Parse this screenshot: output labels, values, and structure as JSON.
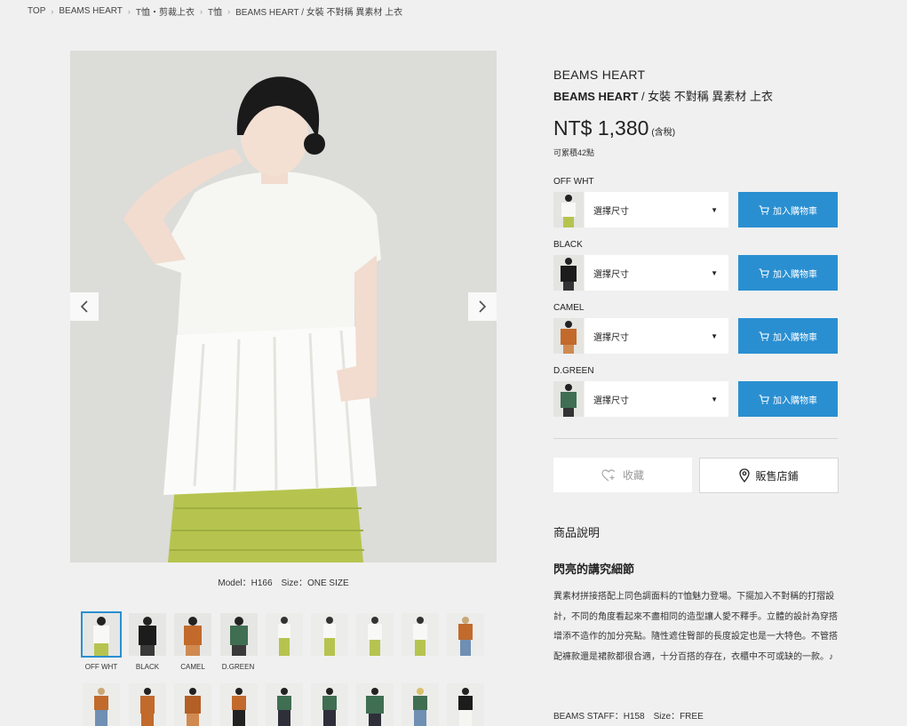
{
  "breadcrumb": [
    "TOP",
    "BEAMS HEART",
    "T恤・剪裁上衣",
    "T恤",
    "BEAMS HEART / 女裝 不對稱 異素材 上衣"
  ],
  "product": {
    "brand": "BEAMS HEART",
    "title_brand": "BEAMS HEART",
    "title_rest": " / 女裝 不對稱 異素材 上衣",
    "price": "NT$ 1,380",
    "tax_note": "(含稅)",
    "points": "可累積42點"
  },
  "gallery": {
    "caption": "Model：H166　Size：ONE SIZE",
    "thumb_labels": [
      "OFF WHT",
      "BLACK",
      "CAMEL",
      "D.GREEN"
    ]
  },
  "variants": [
    {
      "color": "OFF WHT",
      "select": "選擇尺寸",
      "cart": "加入購物車"
    },
    {
      "color": "BLACK",
      "select": "選擇尺寸",
      "cart": "加入購物車"
    },
    {
      "color": "CAMEL",
      "select": "選擇尺寸",
      "cart": "加入購物車"
    },
    {
      "color": "D.GREEN",
      "select": "選擇尺寸",
      "cart": "加入購物車"
    }
  ],
  "actions": {
    "favorite": "收藏",
    "store": "販售店鋪"
  },
  "description": {
    "heading": "商品說明",
    "subheading": "閃亮的講究細節",
    "body": "異素材拼接搭配上同色調面料的T恤魅力登場。下擺加入不對稱的打摺設計，不同的角度看起來不盡相同的造型讓人愛不釋手。立體的設計為穿搭增添不造作的加分亮點。隨性遮住臀部的長度設定也是一大特色。不管搭配褲款還是裙款都很合適，十分百搭的存在，衣櫃中不可或缺的一款。♪",
    "staff": "BEAMS STAFF：H158　Size：FREE"
  },
  "colors": {
    "accent": "#2a8fd1",
    "offwhite": "#f4f4f1",
    "black": "#1c1c1c",
    "camel": "#c26a2c",
    "dgreen": "#3f6e52",
    "skirt": "#b5c34e"
  }
}
